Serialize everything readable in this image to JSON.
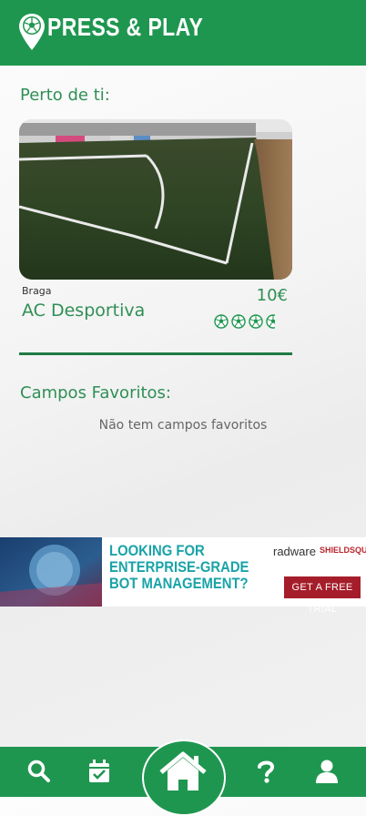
{
  "app": {
    "title": "PRESS & PLAY"
  },
  "nearby": {
    "title": "Perto de ti:",
    "card": {
      "city": "Braga",
      "name": "AC Desportiva",
      "price": "10€",
      "rating": 3.5,
      "rating_max": 4
    }
  },
  "favorites": {
    "title": "Campos Favoritos:",
    "empty_text": "Não tem campos favoritos"
  },
  "ad": {
    "text_line1": "LOOKING FOR",
    "text_line2": "ENTERPRISE-GRADE",
    "text_line3": "BOT MANAGEMENT?",
    "brand1": "radware",
    "brand2": "SHIELDSQUARE",
    "cta": "GET A FREE TRIAL"
  },
  "nav": {
    "items": [
      "search-icon",
      "calendar-check-icon",
      "home-icon",
      "question-icon",
      "user-icon"
    ]
  },
  "colors": {
    "primary": "#1f9650",
    "accent_text": "#2f8f55"
  }
}
